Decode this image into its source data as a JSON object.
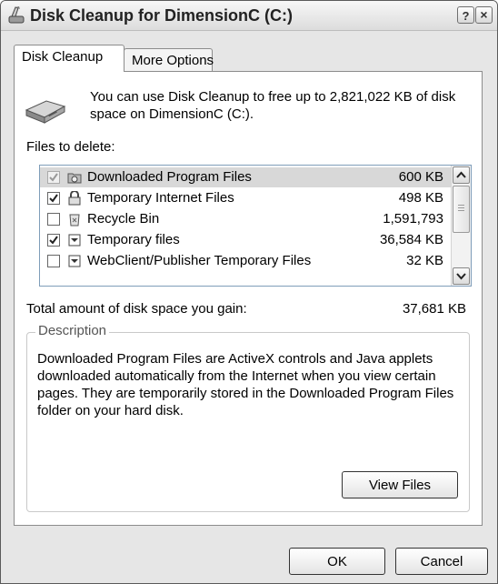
{
  "window": {
    "title": "Disk Cleanup for DimensionC (C:)",
    "help_glyph": "?",
    "close_glyph": "×"
  },
  "tabs": [
    {
      "label": "Disk Cleanup",
      "active": true
    },
    {
      "label": "More Options",
      "active": false
    }
  ],
  "intro": {
    "text": "You can use Disk Cleanup to free up to 2,821,022 KB of disk space on DimensionC (C:)."
  },
  "files_label": "Files to delete:",
  "files": [
    {
      "name": "Downloaded Program Files",
      "size": "600 KB",
      "checked": true,
      "disabled": true,
      "selected": true,
      "icon": "folder-gear-icon"
    },
    {
      "name": "Temporary Internet Files",
      "size": "498 KB",
      "checked": true,
      "disabled": false,
      "selected": false,
      "icon": "lock-icon"
    },
    {
      "name": "Recycle Bin",
      "size": "1,591,793",
      "checked": false,
      "disabled": false,
      "selected": false,
      "icon": "recycle-bin-icon"
    },
    {
      "name": "Temporary files",
      "size": "36,584 KB",
      "checked": true,
      "disabled": false,
      "selected": false,
      "icon": "document-icon"
    },
    {
      "name": "WebClient/Publisher Temporary Files",
      "size": "32 KB",
      "checked": false,
      "disabled": false,
      "selected": false,
      "icon": "document-icon"
    }
  ],
  "total": {
    "label": "Total amount of disk space you gain:",
    "value": "37,681 KB"
  },
  "description": {
    "title": "Description",
    "text": "Downloaded Program Files are ActiveX controls and Java applets downloaded automatically from the Internet when you view certain pages. They are temporarily stored in the Downloaded Program Files folder on your hard disk."
  },
  "buttons": {
    "view_files": "View Files",
    "ok": "OK",
    "cancel": "Cancel"
  }
}
